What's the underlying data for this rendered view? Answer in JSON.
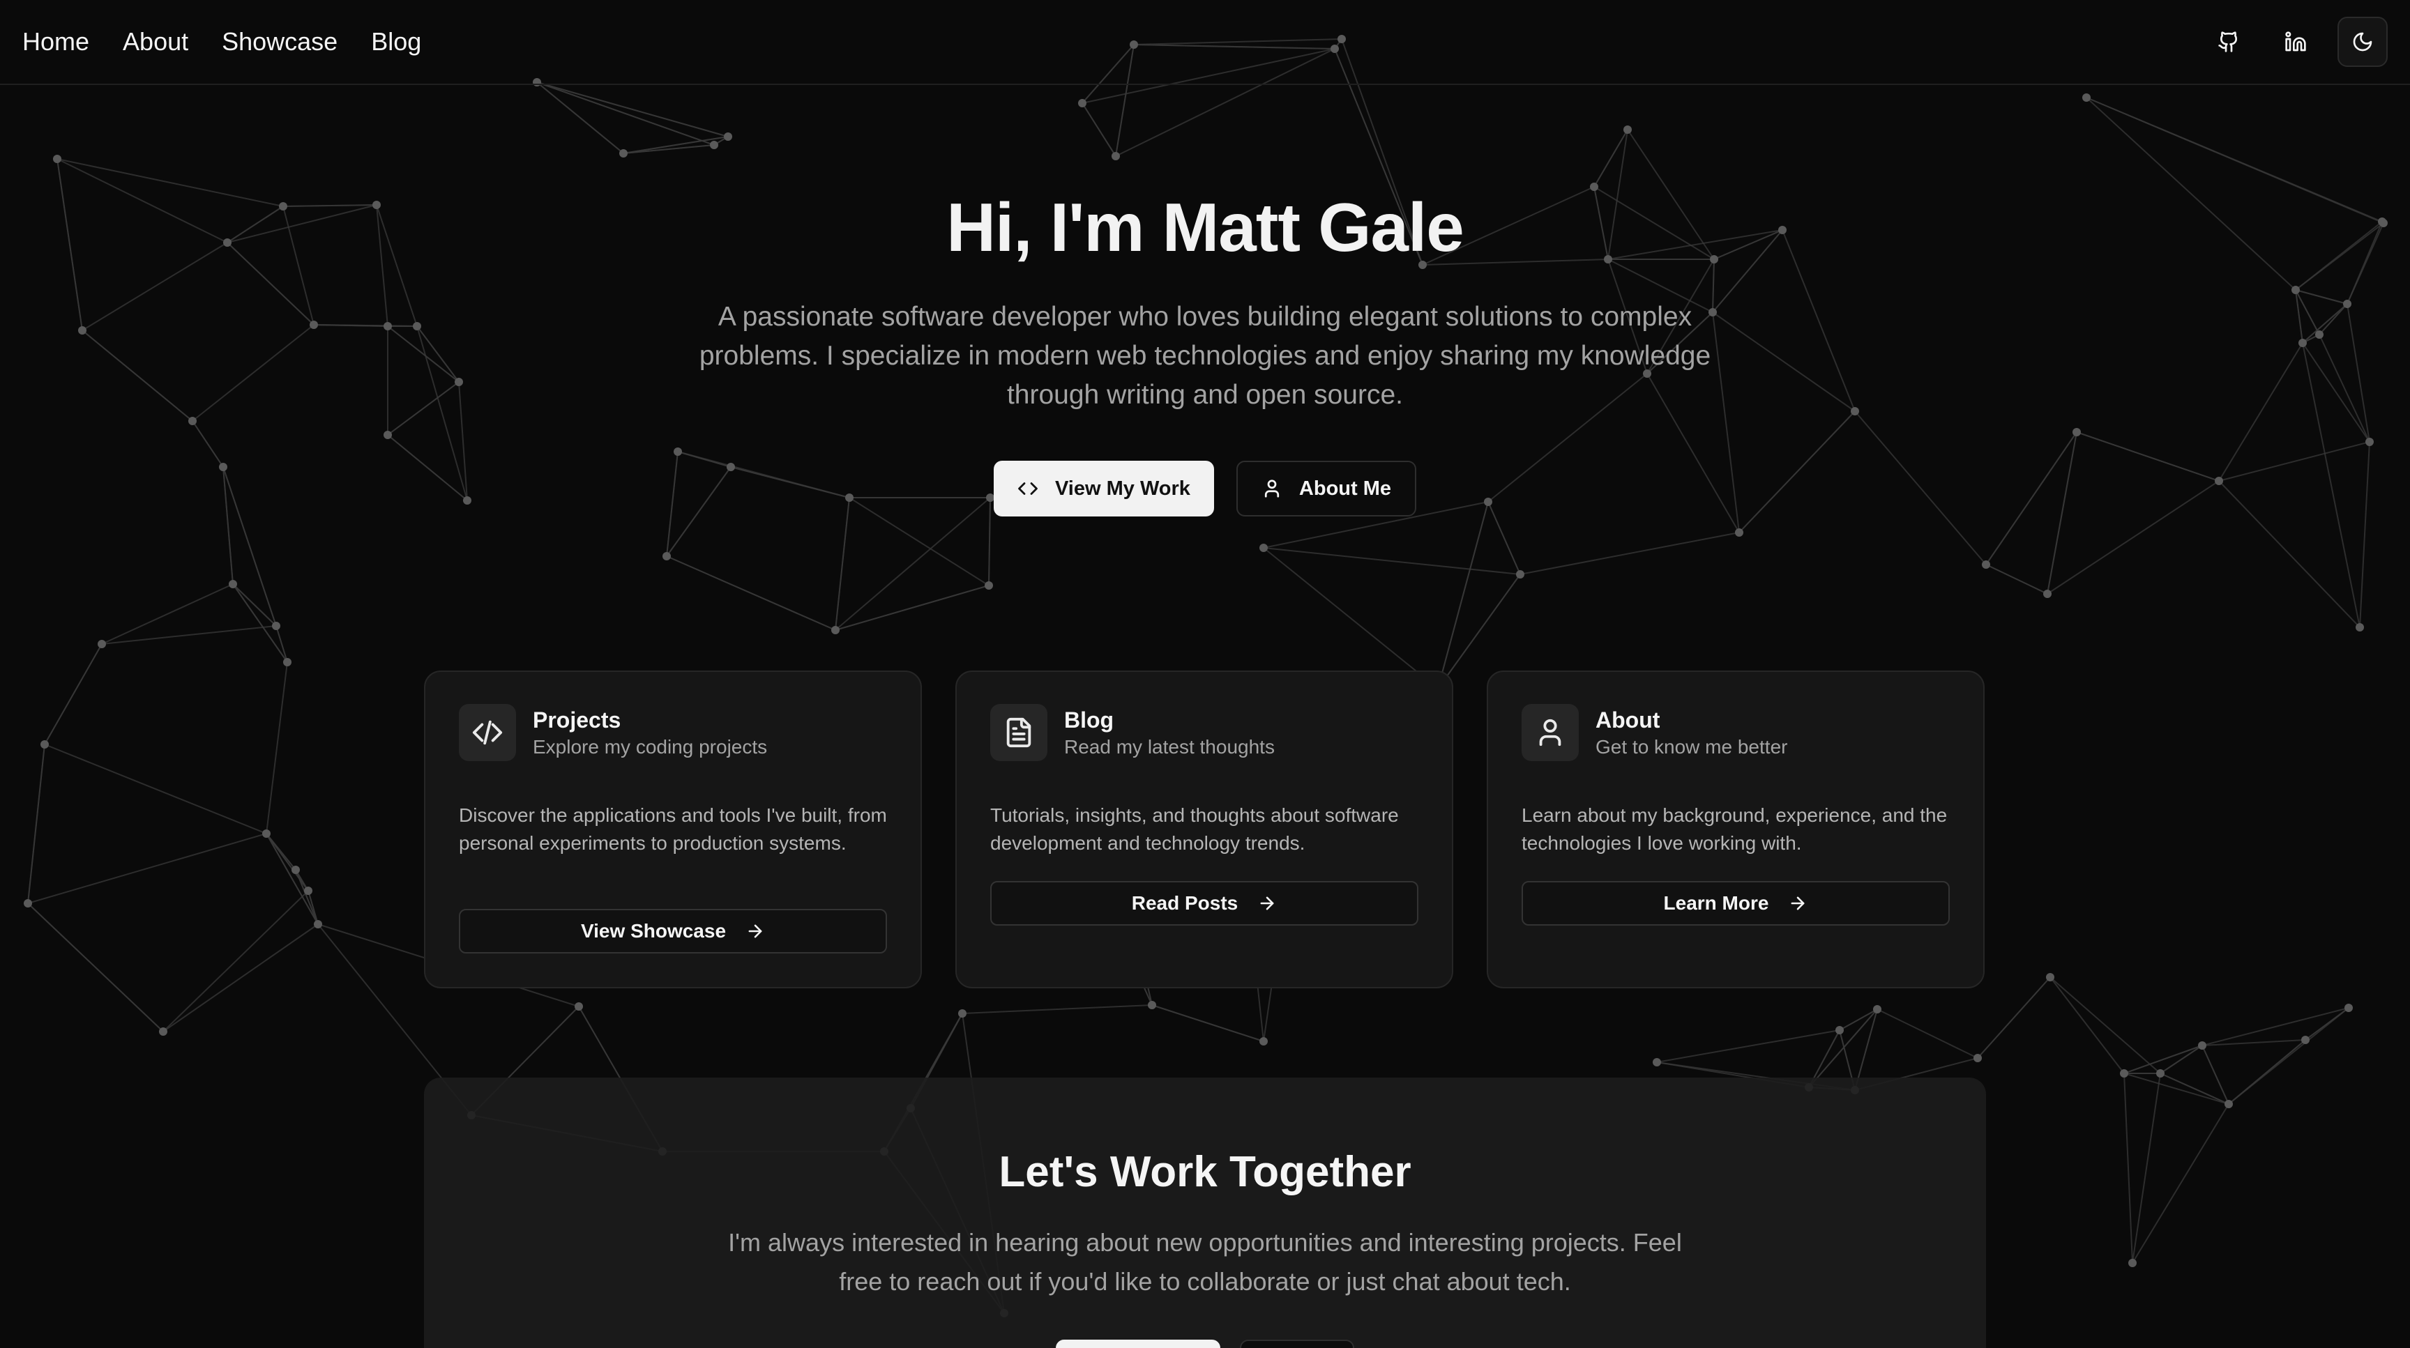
{
  "nav": {
    "links": [
      "Home",
      "About",
      "Showcase",
      "Blog"
    ],
    "icons": [
      "github-icon",
      "linkedin-icon",
      "moon-icon"
    ]
  },
  "hero": {
    "title": "Hi, I'm Matt Gale",
    "subtitle": "A passionate software developer who loves building elegant solutions to complex problems. I specialize in modern web technologies and enjoy sharing my knowledge through writing and open source.",
    "primary_button": "View My Work",
    "secondary_button": "About Me"
  },
  "cards": [
    {
      "icon": "code-icon",
      "title": "Projects",
      "subtitle": "Explore my coding projects",
      "description": "Discover the applications and tools I've built, from personal experiments to production systems.",
      "button": "View Showcase"
    },
    {
      "icon": "file-text-icon",
      "title": "Blog",
      "subtitle": "Read my latest thoughts",
      "description": "Tutorials, insights, and thoughts about software development and technology trends.",
      "button": "Read Posts"
    },
    {
      "icon": "user-icon",
      "title": "About",
      "subtitle": "Get to know me better",
      "description": "Learn about my background, experience, and the technologies I love working with.",
      "button": "Learn More"
    }
  ],
  "cta": {
    "title": "Let's Work Together",
    "subtitle": "I'm always interested in hearing about new opportunities and interesting projects. Feel free to reach out if you'd like to collaborate or just chat about tech."
  },
  "colors": {
    "background": "#0a0a0a",
    "card": "#161616",
    "text": "#f5f5f5",
    "muted": "#a3a3a3",
    "node": "#5a5a5a"
  }
}
